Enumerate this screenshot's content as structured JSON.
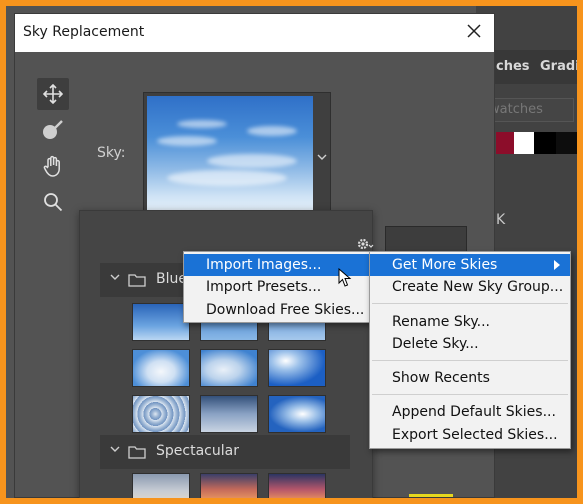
{
  "dialog": {
    "title": "Sky Replacement",
    "sky_label": "Sky:"
  },
  "background_panel": {
    "tab1": "ches",
    "tab2": "Gradie",
    "search_placeholder": "watches",
    "letter": "K",
    "swatches": [
      "#8c0d2a",
      "#ffffff",
      "#000000",
      "#0d0d0d",
      "#1a1a1a"
    ]
  },
  "tools": [
    "move-icon",
    "sky-brush-icon",
    "hand-icon",
    "zoom-icon"
  ],
  "sky_browser": {
    "groups": [
      {
        "name": "Blue",
        "expanded": true
      },
      {
        "name": "Spectacular",
        "expanded": true
      }
    ]
  },
  "gear_menu": {
    "items": [
      "Import Images...",
      "Import Presets...",
      "Download Free Skies..."
    ],
    "highlighted": 0
  },
  "sub_menu": {
    "items": [
      "Get More Skies",
      "Create New Sky Group...",
      "Rename Sky...",
      "Delete Sky...",
      "Show Recents",
      "Append Default Skies...",
      "Export Selected Skies..."
    ],
    "highlighted": 0
  },
  "colors": {
    "highlight": "#1a72d6",
    "frame": "#f7941d"
  }
}
